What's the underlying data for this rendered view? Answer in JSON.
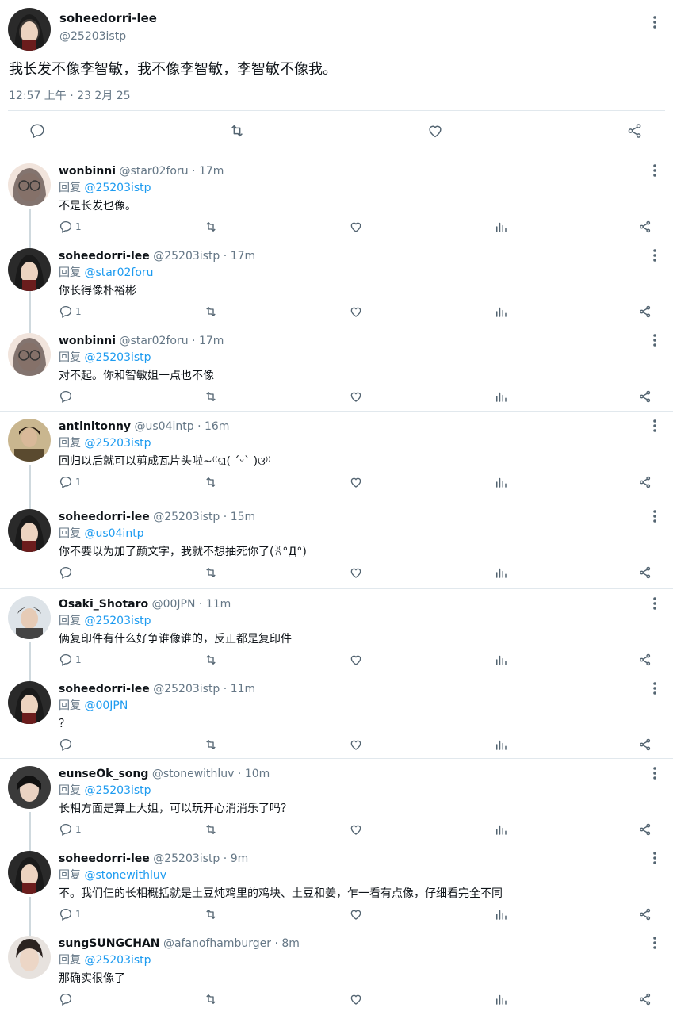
{
  "main": {
    "display_name": "soheedorri-lee",
    "handle": "@25203istp",
    "text": "我长发不像李智敏，我不像李智敏，李智敏不像我。",
    "timestamp": "12:57 上午 · 23 2月 25"
  },
  "reply_prefix": "回复",
  "replies": [
    {
      "name": "wonbinni",
      "handle": "@star02foru",
      "time": "17m",
      "to": "@25203istp",
      "text": "不是长发也像。",
      "reply_count": "1"
    },
    {
      "name": "soheedorri-lee",
      "handle": "@25203istp",
      "time": "17m",
      "to": "@star02foru",
      "text": "你长得像朴裕彬",
      "reply_count": "1"
    },
    {
      "name": "wonbinni",
      "handle": "@star02foru",
      "time": "17m",
      "to": "@25203istp",
      "text": "对不起。你和智敏姐一点也不像",
      "reply_count": ""
    },
    {
      "name": "antinitonny",
      "handle": "@us04intp",
      "time": "16m",
      "to": "@25203istp",
      "text": "回归以后就可以剪成瓦片头啦~⁽⁽ଘ( ˊᵕˋ )ଓ⁾⁾",
      "reply_count": "1"
    },
    {
      "name": "soheedorri-lee",
      "handle": "@25203istp",
      "time": "15m",
      "to": "@us04intp",
      "text": "你不要以为加了颜文字，我就不想抽死你了(ꐦ°Д°)",
      "reply_count": ""
    },
    {
      "name": "Osaki_Shotaro",
      "handle": "@00JPN",
      "time": "11m",
      "to": "@25203istp",
      "text": "俩复印件有什么好争谁像谁的，反正都是复印件",
      "reply_count": "1"
    },
    {
      "name": "soheedorri-lee",
      "handle": "@25203istp",
      "time": "11m",
      "to": "@00JPN",
      "text": "？",
      "reply_count": ""
    },
    {
      "name": "eunseOk_song",
      "handle": "@stonewithluv",
      "time": "10m",
      "to": "@25203istp",
      "text": "长相方面是算上大姐，可以玩开心消消乐了吗？",
      "reply_count": "1"
    },
    {
      "name": "soheedorri-lee",
      "handle": "@25203istp",
      "time": "9m",
      "to": "@stonewithluv",
      "text": "不。我们仨的长相概括就是土豆炖鸡里的鸡块、土豆和姜，乍一看有点像，仔细看完全不同",
      "reply_count": "1"
    },
    {
      "name": "sungSUNGCHAN",
      "handle": "@afanofhamburger",
      "time": "8m",
      "to": "@25203istp",
      "text": "那确实很像了",
      "reply_count": ""
    }
  ],
  "icons": [
    "reply-icon",
    "retweet-icon",
    "like-icon",
    "share-icon",
    "stats-icon",
    "more-icon"
  ],
  "colors": {
    "link": "#1d9bf0",
    "muted": "#657786",
    "divider": "#e1e8ed",
    "thread_line": "#cfd9de"
  }
}
